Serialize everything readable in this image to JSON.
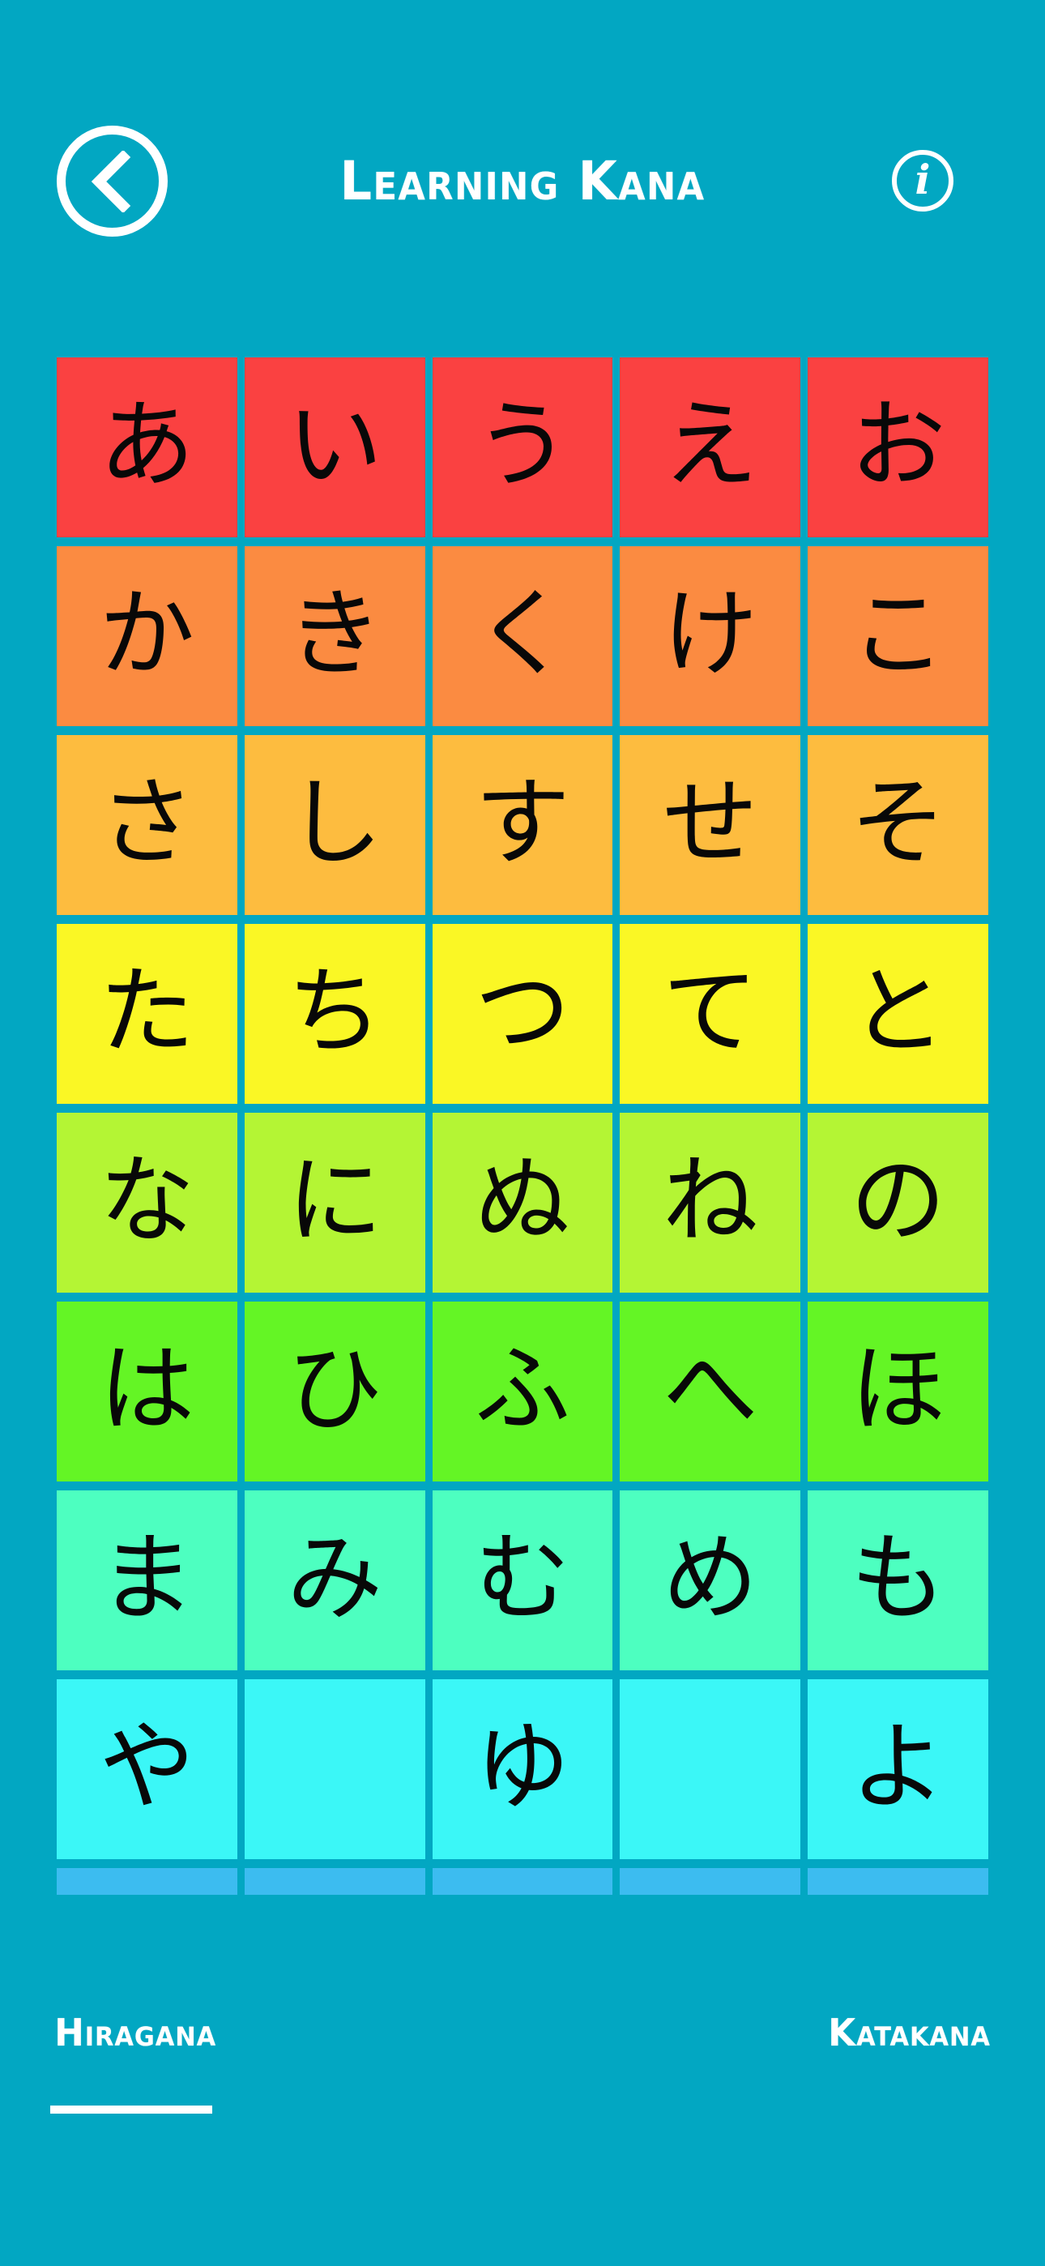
{
  "theme": {
    "background": "#02A7C2",
    "foreground": "#FFFFFF",
    "glyph_color": "#080808"
  },
  "header": {
    "title": "Learning Kana",
    "back_icon": "chevron-left-icon",
    "info_icon": "info-icon",
    "info_glyph": "i"
  },
  "grid": {
    "columns": 5,
    "rows_visible": 8,
    "partial_row_visible": true,
    "row_colors": [
      "#FA4141",
      "#FB8B41",
      "#FDBC3F",
      "#FAF725",
      "#B4F534",
      "#64F525",
      "#4DFFC0",
      "#3BF7F7",
      "#3CBCF0"
    ],
    "rows": [
      {
        "color": "#FA4141",
        "cells": [
          "あ",
          "い",
          "う",
          "え",
          "お"
        ]
      },
      {
        "color": "#FB8B41",
        "cells": [
          "か",
          "き",
          "く",
          "け",
          "こ"
        ]
      },
      {
        "color": "#FDBC3F",
        "cells": [
          "さ",
          "し",
          "す",
          "せ",
          "そ"
        ]
      },
      {
        "color": "#FAF725",
        "cells": [
          "た",
          "ち",
          "つ",
          "て",
          "と"
        ]
      },
      {
        "color": "#B4F534",
        "cells": [
          "な",
          "に",
          "ぬ",
          "ね",
          "の"
        ]
      },
      {
        "color": "#64F525",
        "cells": [
          "は",
          "ひ",
          "ふ",
          "へ",
          "ほ"
        ]
      },
      {
        "color": "#4DFFC0",
        "cells": [
          "ま",
          "み",
          "む",
          "め",
          "も"
        ]
      },
      {
        "color": "#3BF7F7",
        "cells": [
          "や",
          "",
          "ゆ",
          "",
          "よ"
        ]
      },
      {
        "color": "#3CBCF0",
        "cells": [
          "",
          "",
          "",
          "",
          ""
        ]
      }
    ]
  },
  "tabs": {
    "items": [
      {
        "label": "Hiragana",
        "active": true
      },
      {
        "label": "Katakana",
        "active": false
      }
    ],
    "active_index": 0,
    "indicator_color": "#FFFFFF"
  }
}
